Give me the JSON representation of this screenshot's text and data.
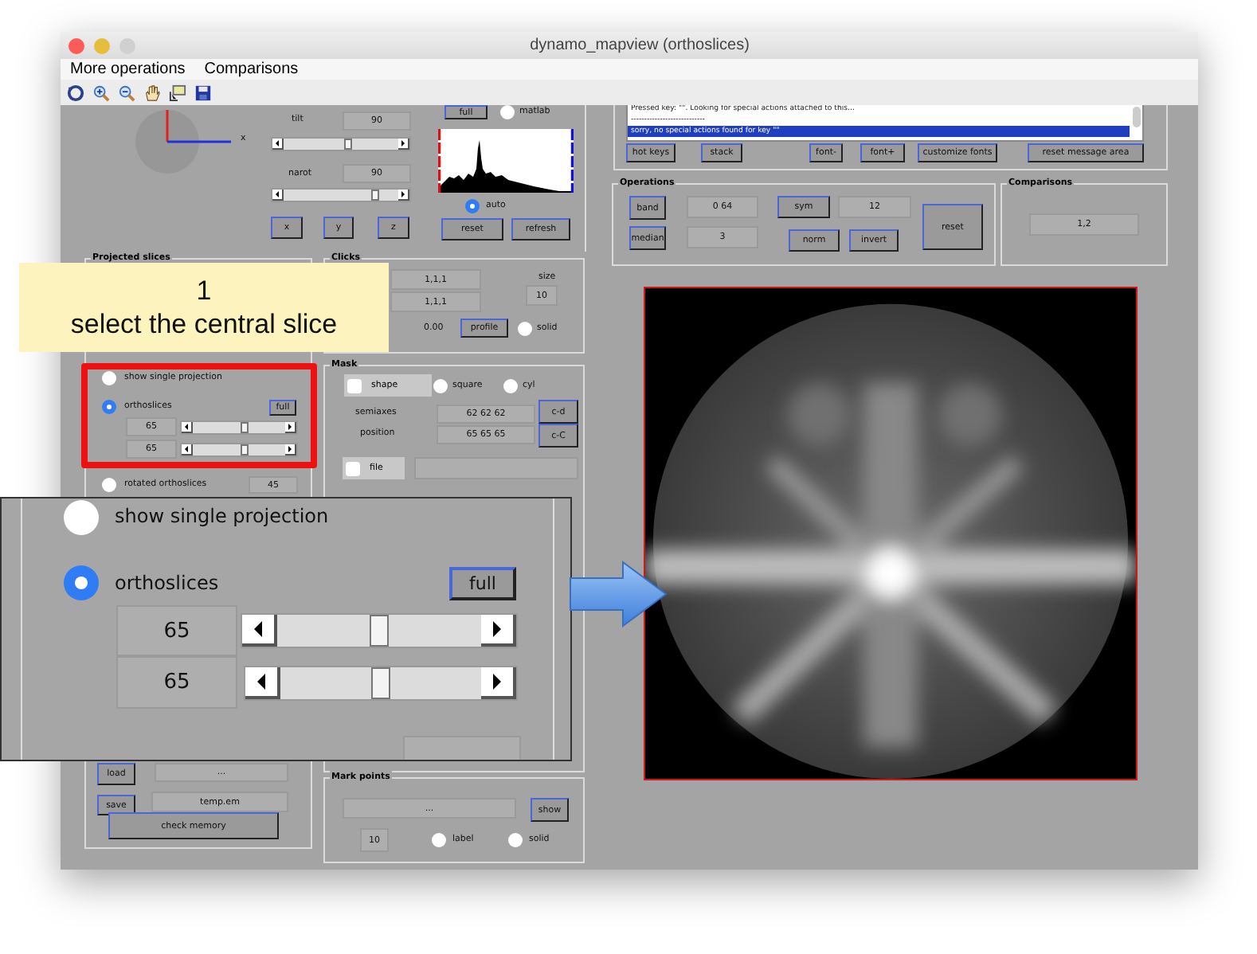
{
  "window": {
    "title": "dynamo_mapview (orthoslices)"
  },
  "menu": [
    {
      "label": "More operations"
    },
    {
      "label": "Comparisons"
    }
  ],
  "view": {
    "axis_label": "x",
    "tilt_label": "tilt",
    "tilt": "90",
    "tilt_slider": {
      "level": 0.55
    },
    "narot_label": "narot",
    "narot": "90",
    "narot_slider": {
      "level": 0.75
    },
    "buttons": [
      "x",
      "y",
      "z"
    ]
  },
  "histogram": {
    "full": "full",
    "matlab": {
      "label": "matlab",
      "selected": false
    },
    "auto": {
      "label": "auto",
      "selected": true
    },
    "reset": "reset",
    "refresh": "refresh"
  },
  "messages": {
    "lines": [
      {
        "text": "Pressed key: \"\".  Looking for special actions attached to this...",
        "selected": false
      },
      {
        "text": "----------------------------",
        "selected": false
      },
      {
        "text": "sorry, no special actions found for key \"\"",
        "selected": true
      }
    ],
    "buttons": [
      "hot keys",
      "stack",
      "font-",
      "font+",
      "customize fonts",
      "reset message area"
    ]
  },
  "operations": {
    "title": "Operations",
    "band": "band",
    "band_value": "0  64",
    "sym": "sym",
    "sym_value": "12",
    "reset": "reset",
    "median": "median",
    "median_value": "3",
    "norm": "norm",
    "invert": "invert"
  },
  "comparisons": {
    "title": "Comparisons",
    "value": "1,2"
  },
  "projected": {
    "title": "Projected slices",
    "options": [
      {
        "label": "show single projection",
        "selected": false
      },
      {
        "label": "orthoslices",
        "selected": true
      },
      {
        "label": "rotated orthoslices",
        "selected": false
      }
    ],
    "full": "full",
    "slices": [
      {
        "value": "65",
        "level": 0.55
      },
      {
        "value": "65",
        "level": 0.55
      }
    ],
    "rotated_value": "45"
  },
  "clicks": {
    "title": "Clicks",
    "fields": [
      "1,1,1",
      "1,1,1"
    ],
    "size_label": "size",
    "size": "10",
    "value": "0.00",
    "profile": "profile",
    "solid": {
      "label": "solid",
      "selected": false
    }
  },
  "mask": {
    "title": "Mask",
    "shape": {
      "label": "shape",
      "checked": false
    },
    "square": {
      "label": "square",
      "selected": false
    },
    "cyl": {
      "label": "cyl",
      "selected": false
    },
    "semiaxes_label": "semiaxes",
    "semiaxes": "62  62  62",
    "cd": "c-d",
    "position_label": "position",
    "position": "65  65  65",
    "cc": "c-C",
    "file": {
      "label": "file",
      "checked": false
    }
  },
  "files": {
    "load": "load",
    "load_value": "...",
    "save": "save",
    "save_value": "temp.em",
    "memory": "check memory"
  },
  "mark_points": {
    "title": "Mark points",
    "value": "...",
    "show": "show",
    "size": "10",
    "label": {
      "label": "label",
      "selected": false
    },
    "solid": {
      "label": "solid",
      "selected": false
    }
  },
  "callout": {
    "step": "1",
    "text": "select the central slice"
  },
  "inset": {
    "options": [
      {
        "label": "show single projection",
        "selected": false
      },
      {
        "label": "orthoslices",
        "selected": true
      }
    ],
    "full": "full",
    "slices": [
      {
        "value": "65",
        "level": 0.5
      },
      {
        "value": "65",
        "level": 0.5
      }
    ]
  }
}
